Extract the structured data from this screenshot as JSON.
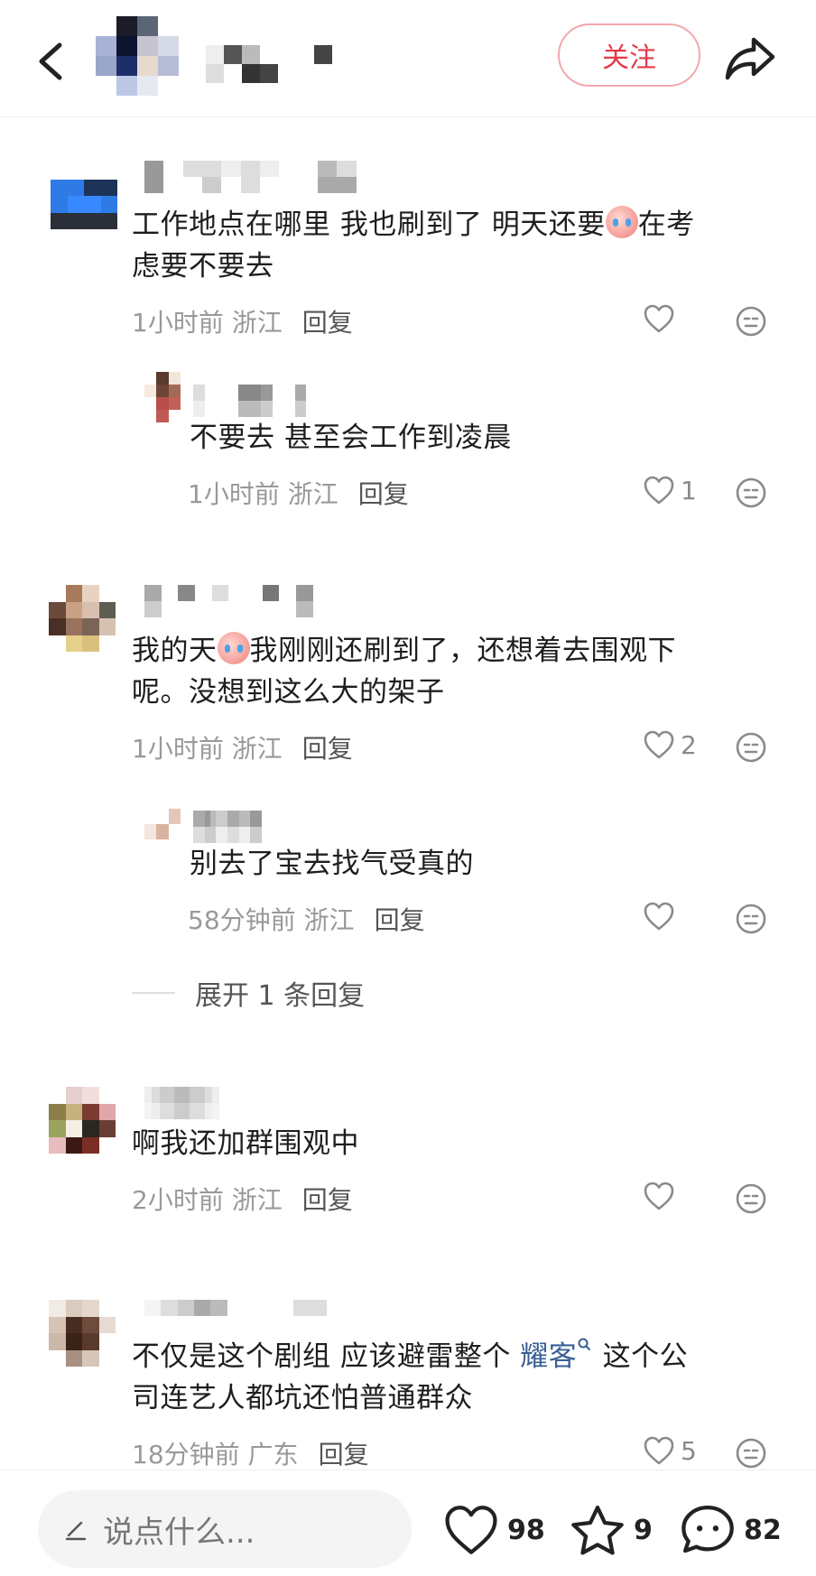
{
  "header": {
    "follow_label": "关注"
  },
  "comments": [
    {
      "text": [
        "工作地点在哪里 我也刷到了 明天还要",
        "在考",
        "虑要不要去"
      ],
      "time": "1小时前",
      "location": "浙江",
      "reply_label": "回复",
      "likes": ""
    },
    {
      "text": [
        "不要去 甚至会工作到凌晨"
      ],
      "time": "1小时前",
      "location": "浙江",
      "reply_label": "回复",
      "likes": "1"
    },
    {
      "text": [
        "我的天",
        "我刚刚还刷到了，还想着去围观下",
        "呢。没想到这么大的架子"
      ],
      "time": "1小时前",
      "location": "浙江",
      "reply_label": "回复",
      "likes": "2"
    },
    {
      "text": [
        "别去了宝去找气受真的"
      ],
      "time": "58分钟前",
      "location": "浙江",
      "reply_label": "回复",
      "likes": ""
    },
    {
      "text": [
        "啊我还加群围观中"
      ],
      "time": "2小时前",
      "location": "浙江",
      "reply_label": "回复",
      "likes": ""
    },
    {
      "text": [
        "不仅是这个剧组 应该避雷整个 ",
        "耀客",
        " 这个公",
        "司连艺人都坑还怕普通群众"
      ],
      "time": "18分钟前",
      "location": "广东",
      "reply_label": "回复",
      "likes": "5"
    }
  ],
  "expand_replies": "展开 1 条回复",
  "bottom_bar": {
    "input_placeholder": "说点什么...",
    "like_count": "98",
    "collect_count": "9",
    "comment_count": "82"
  },
  "colors": {
    "accent": "#e33b49",
    "follow_border": "#f2a7ac",
    "meta_text": "#999999",
    "topic_link": "#3a5f94"
  },
  "icons": [
    "back-arrow-icon",
    "share-icon",
    "heart-icon",
    "react-emoji-icon",
    "pen-icon",
    "star-icon",
    "comment-bubble-icon",
    "search-icon",
    "crying-emoji-icon"
  ]
}
